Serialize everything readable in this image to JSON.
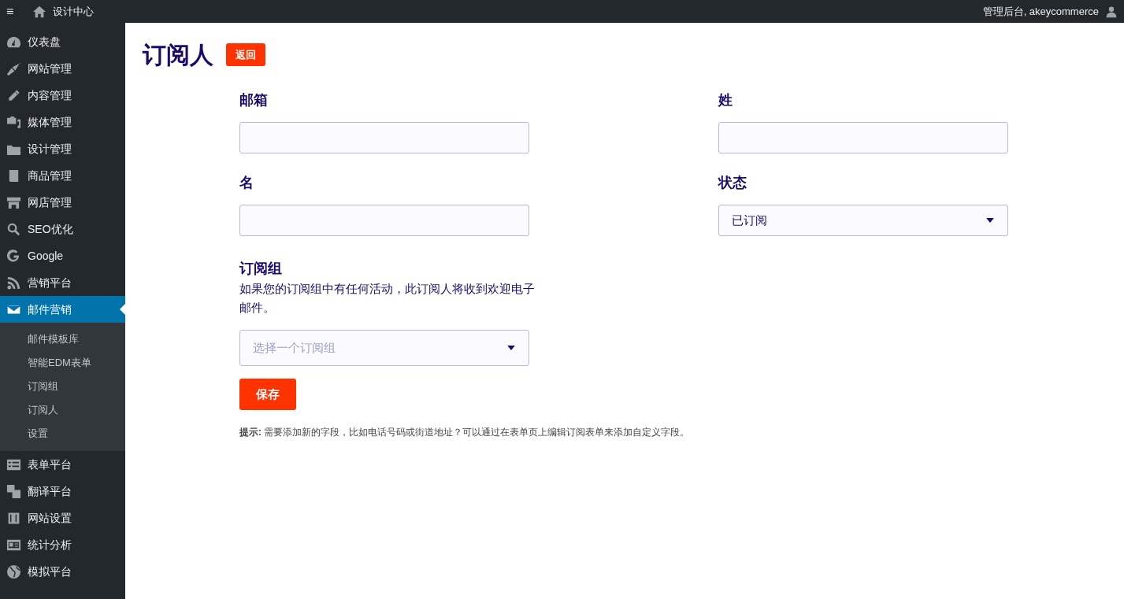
{
  "topbar": {
    "menu_glyph": "≡",
    "site_name": "设计中心",
    "account": "管理后台, akeycommerce"
  },
  "sidebar": {
    "items": [
      {
        "label": "仪表盘",
        "selected": false
      },
      {
        "label": "网站管理",
        "selected": false
      },
      {
        "label": "内容管理",
        "selected": false
      },
      {
        "label": "媒体管理",
        "selected": false
      },
      {
        "label": "设计管理",
        "selected": false
      },
      {
        "label": "商品管理",
        "selected": false
      },
      {
        "label": "网店管理",
        "selected": false
      },
      {
        "label": "SEO优化",
        "selected": false
      },
      {
        "label": "Google",
        "selected": false
      },
      {
        "label": "营销平台",
        "selected": false
      },
      {
        "label": "邮件营销",
        "selected": true,
        "children": [
          {
            "label": "邮件模板库"
          },
          {
            "label": "智能EDM表单"
          },
          {
            "label": "订阅组"
          },
          {
            "label": "订阅人"
          },
          {
            "label": "设置"
          }
        ]
      },
      {
        "label": "表单平台",
        "selected": false
      },
      {
        "label": "翻译平台",
        "selected": false
      },
      {
        "label": "网站设置",
        "selected": false
      },
      {
        "label": "统计分析",
        "selected": false
      },
      {
        "label": "模拟平台",
        "selected": false
      }
    ]
  },
  "page": {
    "title": "订阅人",
    "back_button": "返回"
  },
  "form": {
    "fields": [
      {
        "label": "邮箱",
        "kind": "input"
      },
      {
        "label": "姓",
        "kind": "input"
      },
      {
        "label": "名",
        "kind": "input"
      },
      {
        "label": "状态",
        "kind": "select",
        "value": "已订阅"
      }
    ],
    "group": {
      "label": "订阅组",
      "help": "如果您的订阅组中有任何活动，此订阅人将收到欢迎电子邮件。",
      "placeholder": "选择一个订阅组"
    },
    "save_button": "保存",
    "hint": "**提示:** 需要添加新的字段，比如电话号码或街道地址？可以通过在表单页上编辑订阅表单来添加自定义字段。"
  }
}
